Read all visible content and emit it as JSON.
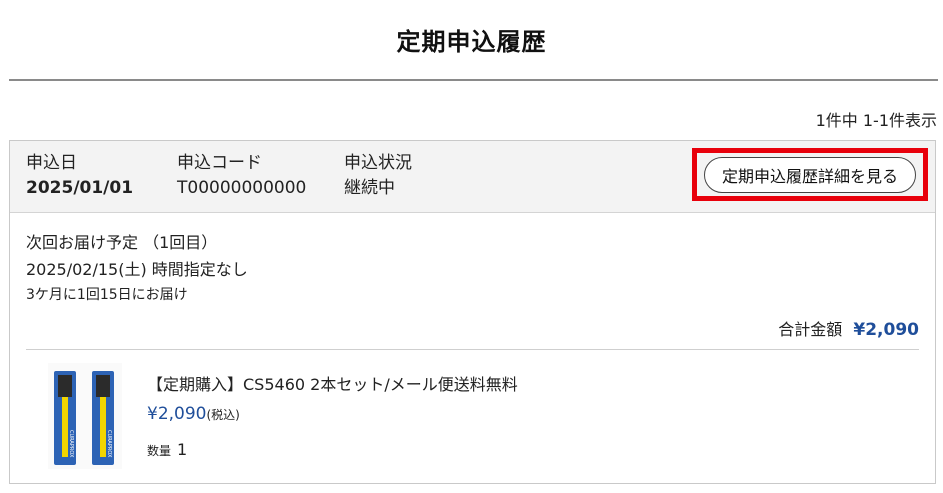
{
  "page": {
    "title": "定期申込履歴"
  },
  "pagination": {
    "text": "1件中 1-1件表示"
  },
  "order": {
    "labels": {
      "date": "申込日",
      "code": "申込コード",
      "status": "申込状況"
    },
    "date": "2025/01/01",
    "code": "T00000000000",
    "status": "継続中",
    "detail_button": "定期申込履歴詳細を見る",
    "highlight_color": "#e8000b"
  },
  "delivery": {
    "label": "次回お届け予定 （1回目）",
    "date": "2025/02/15(土) 時間指定なし",
    "frequency": "3ケ月に1回15日にお届け"
  },
  "total": {
    "label": "合計金額",
    "amount": "¥2,090",
    "accent_color": "#1f4e9a"
  },
  "product": {
    "name": "【定期購入】CS5460 2本セット/メール便送料無料",
    "price": "¥2,090",
    "tax_note": "(税込)",
    "qty_label": "数量",
    "qty": "1",
    "image_icon": "toothbrush-product-image",
    "brand_on_image": "CURAPROX"
  }
}
